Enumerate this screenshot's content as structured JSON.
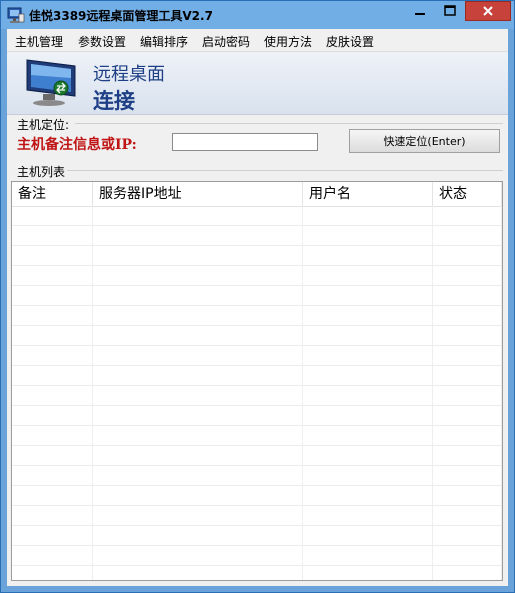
{
  "window": {
    "title": "佳悦3389远程桌面管理工具V2.7",
    "controls": {
      "minimize_icon": "minimize-icon",
      "maximize_icon": "maximize-icon",
      "close_icon": "close-icon"
    }
  },
  "menu": {
    "items": [
      {
        "label": "主机管理"
      },
      {
        "label": "参数设置"
      },
      {
        "label": "编辑排序"
      },
      {
        "label": "启动密码"
      },
      {
        "label": "使用方法"
      },
      {
        "label": "皮肤设置"
      }
    ]
  },
  "banner": {
    "line1": "远程桌面",
    "line2": "连接",
    "text_color": "#1e3f86"
  },
  "locate": {
    "group_label": "主机定位:",
    "field_label": "主机备注信息或IP:",
    "field_label_color": "#c01313",
    "input_value": "",
    "button_label": "快速定位(Enter)"
  },
  "host_list": {
    "group_label": "主机列表",
    "columns": [
      "备注",
      "服务器IP地址",
      "用户名",
      "状态"
    ],
    "rows": []
  },
  "colors": {
    "titlebar": "#72aee6",
    "close_button": "#c7423a"
  }
}
